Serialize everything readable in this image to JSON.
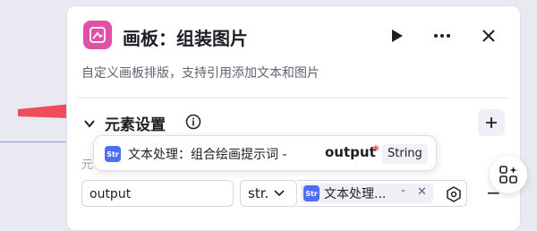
{
  "node": {
    "title": "画板：组装图片",
    "description": "自定义画板排版，支持引用添加文本和图片",
    "icon": "canvas-icon",
    "accent_color": "#e04fa8"
  },
  "header_actions": {
    "run_icon": "play-icon",
    "more_icon": "more-icon",
    "close_icon": "close-icon"
  },
  "section": {
    "title": "元素设置",
    "partial_label": "元"
  },
  "element_row": {
    "name_value": "output",
    "type_value": "str.",
    "reference_text": "文本处理...",
    "reference_icon_label": "Str",
    "reference_dash": "-"
  },
  "tooltip": {
    "text": "文本处理：组合绘画提示词 - ",
    "output": "output",
    "required": "*",
    "type": "String"
  },
  "colors": {
    "arrow": "#ee4d5d",
    "ref_icon": "#4f6ef7",
    "required": "#e5484d"
  }
}
